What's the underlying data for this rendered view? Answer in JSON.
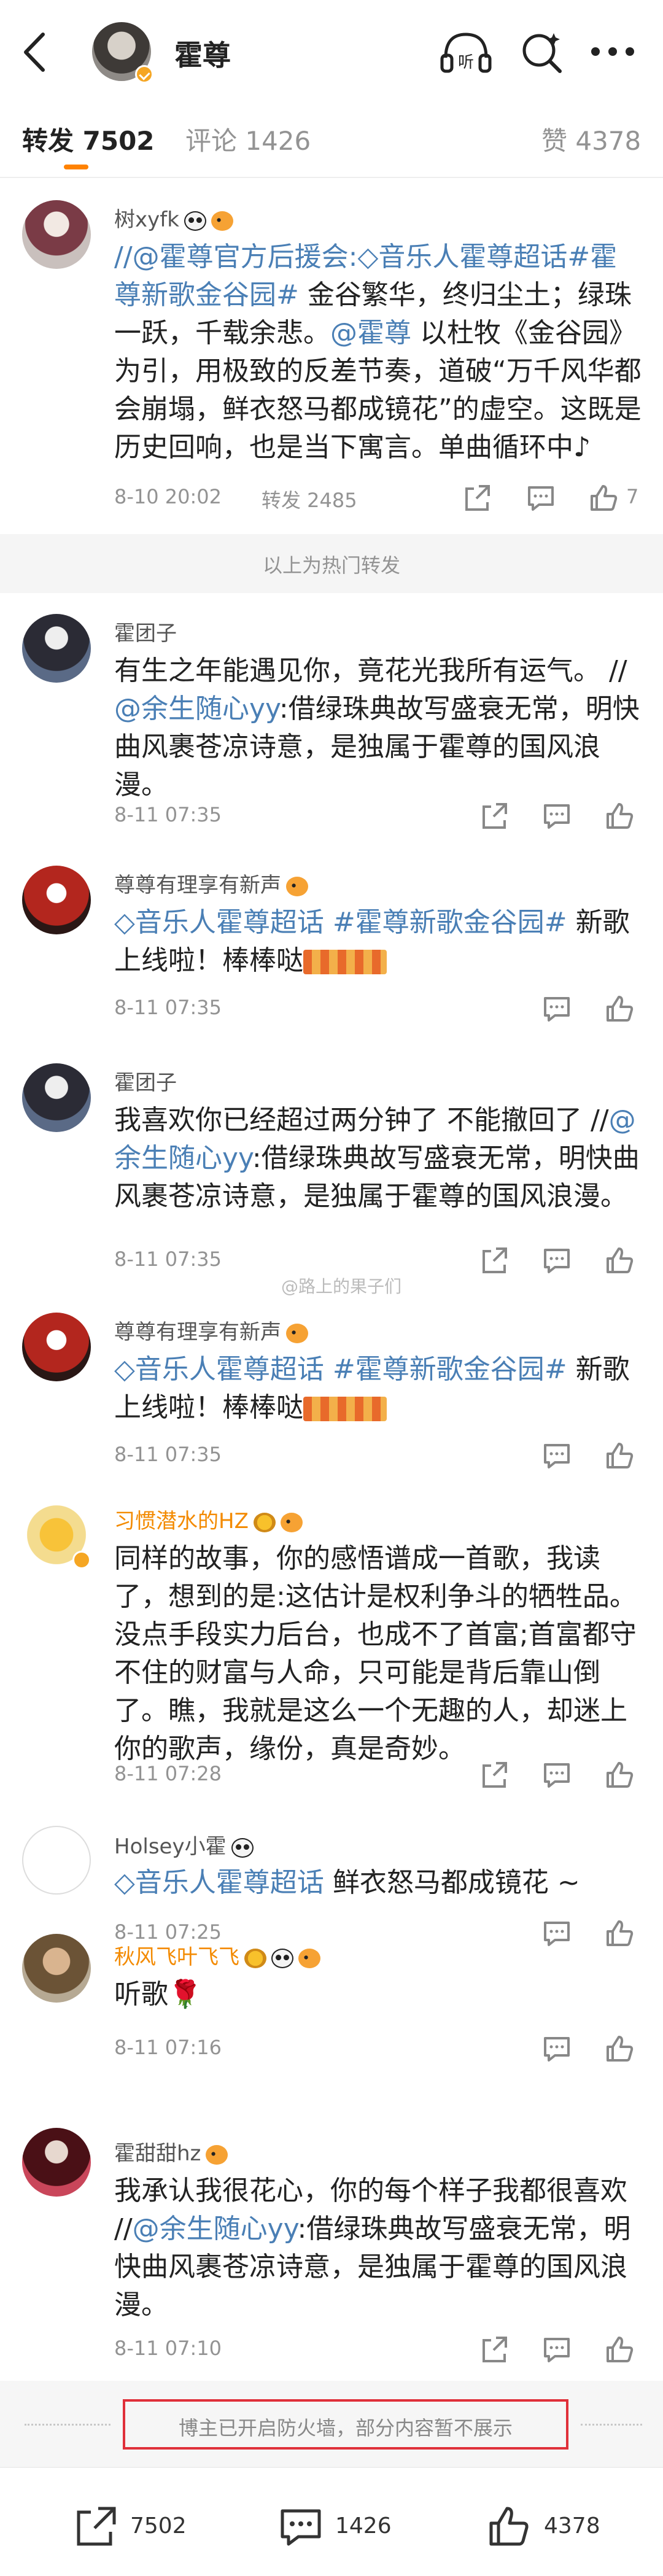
{
  "header": {
    "title": "霍尊",
    "listen_label": "听"
  },
  "tabs": {
    "repost_label": "转发 7502",
    "comment_label": "评论 1426",
    "like_label": "赞 4378"
  },
  "hot_divider": "以上为热门转发",
  "watermark": "@路上的果子们",
  "items": [
    {
      "user": "树xyfk",
      "body_link1": "//@霍尊官方后援会:",
      "body_link2": "音乐人霍尊超话",
      "body_link3": "#霍尊新歌金谷园#",
      "body_text1": " 金谷繁华，终归尘土；绿珠一跃，千载余悲。",
      "body_link4": "@霍尊",
      "body_text2": " 以杜牧《金谷园》为引，用极致的反差节奏，道破“万千风华都会崩塌，鲜衣怒马都成镜花”的虚空。这既是历史回响，也是当下寓言。单曲循环中♪",
      "time": "8-10 20:02",
      "repost_text": "转发 2485",
      "like_count": "7"
    },
    {
      "user": "霍团子",
      "body_text1": "有生之年能遇见你，竟花光我所有运气。 //",
      "body_link1": "@余生随心yy",
      "body_text2": ":借绿珠典故写盛衰无常，明快曲风裹苍凉诗意，是独属于霍尊的国风浪漫。",
      "time": "8-11 07:35"
    },
    {
      "user": "尊尊有理享有新声",
      "body_link1": "音乐人霍尊超话",
      "body_link2": "#霍尊新歌金谷园#",
      "body_text1": " 新歌上线啦！棒棒哒",
      "time": "8-11 07:35"
    },
    {
      "user": "霍团子",
      "body_text1": "我喜欢你已经超过两分钟了 不能撤回了 //",
      "body_link1": "@余生随心yy",
      "body_text2": ":借绿珠典故写盛衰无常，明快曲风裹苍凉诗意，是独属于霍尊的国风浪漫。",
      "time": "8-11 07:35"
    },
    {
      "user": "尊尊有理享有新声",
      "body_link1": "音乐人霍尊超话",
      "body_link2": "#霍尊新歌金谷园#",
      "body_text1": " 新歌上线啦！棒棒哒",
      "time": "8-11 07:35"
    },
    {
      "user": "习惯潜水的HZ",
      "body_text1": "同样的故事，你的感悟谱成一首歌，我读了，想到的是:这估计是权利争斗的牺牲品。没点手段实力后台，也成不了首富;首富都守不住的财富与人命，只可能是背后靠山倒了。瞧，我就是这么一个无趣的人，却迷上你的歌声，缘份，真是奇妙。",
      "time": "8-11 07:28"
    },
    {
      "user": "Holsey小霍",
      "body_link1": "音乐人霍尊超话",
      "body_text1": " 鲜衣怒马都成镜花 ~",
      "time": "8-11 07:25"
    },
    {
      "user": "秋风飞叶飞飞",
      "body_text1": "听歌🌹",
      "time": "8-11 07:16"
    },
    {
      "user": "霍甜甜hz",
      "body_text1": "我承认我很花心，你的每个样子我都很喜欢 //",
      "body_link1": "@余生随心yy",
      "body_text2": ":借绿珠典故写盛衰无常，明快曲风裹苍凉诗意，是独属于霍尊的国风浪漫。",
      "time": "8-11 07:10"
    }
  ],
  "firewall_notice": "博主已开启防火墙，部分内容暂不展示",
  "bottom_bar": {
    "repost_count": "7502",
    "comment_count": "1426",
    "like_count": "4378"
  },
  "colors": {
    "accent": "#ff8200",
    "link": "#4a7fb5",
    "highlight_box": "#e0303a"
  }
}
